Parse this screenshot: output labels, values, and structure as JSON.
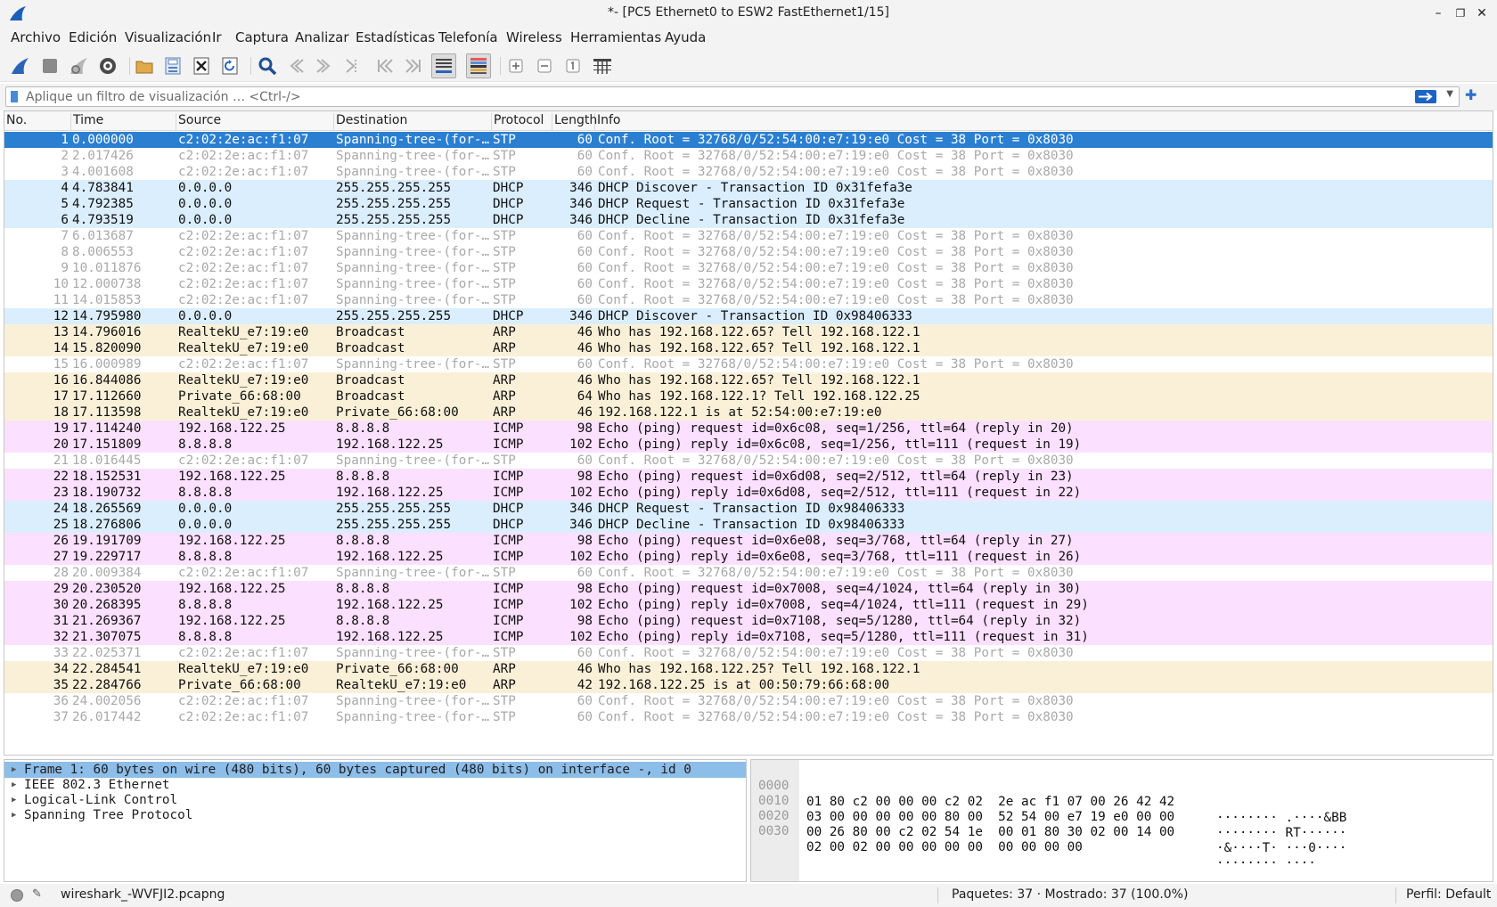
{
  "window": {
    "title": "*- [PC5 Ethernet0 to ESW2 FastEthernet1/15]",
    "controls": {
      "minimize": "–",
      "restore": "❐",
      "close": "✕"
    }
  },
  "menu": {
    "items": [
      {
        "label": "Archivo"
      },
      {
        "label": "Edición"
      },
      {
        "label": "Visualización"
      },
      {
        "label": "Ir"
      },
      {
        "label": "Captura"
      },
      {
        "label": "Analizar"
      },
      {
        "label": "Estadísticas"
      },
      {
        "label": "Telefonía"
      },
      {
        "label": "Wireless"
      },
      {
        "label": "Herramientas"
      },
      {
        "label": "Ayuda"
      }
    ]
  },
  "toolbar": {
    "buttons": [
      "start-capture-icon",
      "stop-capture-icon",
      "restart-capture-icon",
      "capture-options-icon",
      "open-file-icon",
      "save-file-icon",
      "close-file-icon",
      "reload-file-icon",
      "find-packet-icon",
      "go-back-icon",
      "go-forward-icon",
      "go-to-packet-icon",
      "first-packet-icon",
      "last-packet-icon",
      "auto-scroll-icon",
      "colorize-icon",
      "zoom-in-icon",
      "zoom-out-icon",
      "normal-size-icon",
      "resize-columns-icon"
    ]
  },
  "filter": {
    "placeholder": "Aplique un filtro de visualización … <Ctrl-/>"
  },
  "packet_list": {
    "columns": [
      "No.",
      "Time",
      "Source",
      "Destination",
      "Protocol",
      "Length",
      "Info"
    ],
    "rows": [
      {
        "no": "1",
        "time": "0.000000",
        "src": "c2:02:2e:ac:f1:07",
        "dst": "Spanning-tree-(for-…",
        "proto": "STP",
        "len": "60",
        "info": "Conf. Root = 32768/0/52:54:00:e7:19:e0  Cost = 38  Port = 0x8030",
        "cls": "selected"
      },
      {
        "no": "2",
        "time": "2.017426",
        "src": "c2:02:2e:ac:f1:07",
        "dst": "Spanning-tree-(for-…",
        "proto": "STP",
        "len": "60",
        "info": "Conf. Root = 32768/0/52:54:00:e7:19:e0  Cost = 38  Port = 0x8030",
        "cls": "stp"
      },
      {
        "no": "3",
        "time": "4.001608",
        "src": "c2:02:2e:ac:f1:07",
        "dst": "Spanning-tree-(for-…",
        "proto": "STP",
        "len": "60",
        "info": "Conf. Root = 32768/0/52:54:00:e7:19:e0  Cost = 38  Port = 0x8030",
        "cls": "stp"
      },
      {
        "no": "4",
        "time": "4.783841",
        "src": "0.0.0.0",
        "dst": "255.255.255.255",
        "proto": "DHCP",
        "len": "346",
        "info": "DHCP Discover - Transaction ID 0x31fefa3e",
        "cls": "dhcp"
      },
      {
        "no": "5",
        "time": "4.792385",
        "src": "0.0.0.0",
        "dst": "255.255.255.255",
        "proto": "DHCP",
        "len": "346",
        "info": "DHCP Request  - Transaction ID 0x31fefa3e",
        "cls": "dhcp"
      },
      {
        "no": "6",
        "time": "4.793519",
        "src": "0.0.0.0",
        "dst": "255.255.255.255",
        "proto": "DHCP",
        "len": "346",
        "info": "DHCP Decline  - Transaction ID 0x31fefa3e",
        "cls": "dhcp"
      },
      {
        "no": "7",
        "time": "6.013687",
        "src": "c2:02:2e:ac:f1:07",
        "dst": "Spanning-tree-(for-…",
        "proto": "STP",
        "len": "60",
        "info": "Conf. Root = 32768/0/52:54:00:e7:19:e0  Cost = 38  Port = 0x8030",
        "cls": "stp"
      },
      {
        "no": "8",
        "time": "8.006553",
        "src": "c2:02:2e:ac:f1:07",
        "dst": "Spanning-tree-(for-…",
        "proto": "STP",
        "len": "60",
        "info": "Conf. Root = 32768/0/52:54:00:e7:19:e0  Cost = 38  Port = 0x8030",
        "cls": "stp"
      },
      {
        "no": "9",
        "time": "10.011876",
        "src": "c2:02:2e:ac:f1:07",
        "dst": "Spanning-tree-(for-…",
        "proto": "STP",
        "len": "60",
        "info": "Conf. Root = 32768/0/52:54:00:e7:19:e0  Cost = 38  Port = 0x8030",
        "cls": "stp"
      },
      {
        "no": "10",
        "time": "12.000738",
        "src": "c2:02:2e:ac:f1:07",
        "dst": "Spanning-tree-(for-…",
        "proto": "STP",
        "len": "60",
        "info": "Conf. Root = 32768/0/52:54:00:e7:19:e0  Cost = 38  Port = 0x8030",
        "cls": "stp"
      },
      {
        "no": "11",
        "time": "14.015853",
        "src": "c2:02:2e:ac:f1:07",
        "dst": "Spanning-tree-(for-…",
        "proto": "STP",
        "len": "60",
        "info": "Conf. Root = 32768/0/52:54:00:e7:19:e0  Cost = 38  Port = 0x8030",
        "cls": "stp"
      },
      {
        "no": "12",
        "time": "14.795980",
        "src": "0.0.0.0",
        "dst": "255.255.255.255",
        "proto": "DHCP",
        "len": "346",
        "info": "DHCP Discover - Transaction ID 0x98406333",
        "cls": "dhcp"
      },
      {
        "no": "13",
        "time": "14.796016",
        "src": "RealtekU_e7:19:e0",
        "dst": "Broadcast",
        "proto": "ARP",
        "len": "46",
        "info": "Who has 192.168.122.65? Tell 192.168.122.1",
        "cls": "arp"
      },
      {
        "no": "14",
        "time": "15.820090",
        "src": "RealtekU_e7:19:e0",
        "dst": "Broadcast",
        "proto": "ARP",
        "len": "46",
        "info": "Who has 192.168.122.65? Tell 192.168.122.1",
        "cls": "arp"
      },
      {
        "no": "15",
        "time": "16.000989",
        "src": "c2:02:2e:ac:f1:07",
        "dst": "Spanning-tree-(for-…",
        "proto": "STP",
        "len": "60",
        "info": "Conf. Root = 32768/0/52:54:00:e7:19:e0  Cost = 38  Port = 0x8030",
        "cls": "stp"
      },
      {
        "no": "16",
        "time": "16.844086",
        "src": "RealtekU_e7:19:e0",
        "dst": "Broadcast",
        "proto": "ARP",
        "len": "46",
        "info": "Who has 192.168.122.65? Tell 192.168.122.1",
        "cls": "arp"
      },
      {
        "no": "17",
        "time": "17.112660",
        "src": "Private_66:68:00",
        "dst": "Broadcast",
        "proto": "ARP",
        "len": "64",
        "info": "Who has 192.168.122.1? Tell 192.168.122.25",
        "cls": "arp"
      },
      {
        "no": "18",
        "time": "17.113598",
        "src": "RealtekU_e7:19:e0",
        "dst": "Private_66:68:00",
        "proto": "ARP",
        "len": "46",
        "info": "192.168.122.1 is at 52:54:00:e7:19:e0",
        "cls": "arp"
      },
      {
        "no": "19",
        "time": "17.114240",
        "src": "192.168.122.25",
        "dst": "8.8.8.8",
        "proto": "ICMP",
        "len": "98",
        "info": "Echo (ping) request  id=0x6c08, seq=1/256, ttl=64 (reply in 20)",
        "cls": "icmp"
      },
      {
        "no": "20",
        "time": "17.151809",
        "src": "8.8.8.8",
        "dst": "192.168.122.25",
        "proto": "ICMP",
        "len": "102",
        "info": "Echo (ping) reply    id=0x6c08, seq=1/256, ttl=111 (request in 19)",
        "cls": "icmp"
      },
      {
        "no": "21",
        "time": "18.016445",
        "src": "c2:02:2e:ac:f1:07",
        "dst": "Spanning-tree-(for-…",
        "proto": "STP",
        "len": "60",
        "info": "Conf. Root = 32768/0/52:54:00:e7:19:e0  Cost = 38  Port = 0x8030",
        "cls": "stp"
      },
      {
        "no": "22",
        "time": "18.152531",
        "src": "192.168.122.25",
        "dst": "8.8.8.8",
        "proto": "ICMP",
        "len": "98",
        "info": "Echo (ping) request  id=0x6d08, seq=2/512, ttl=64 (reply in 23)",
        "cls": "icmp"
      },
      {
        "no": "23",
        "time": "18.190732",
        "src": "8.8.8.8",
        "dst": "192.168.122.25",
        "proto": "ICMP",
        "len": "102",
        "info": "Echo (ping) reply    id=0x6d08, seq=2/512, ttl=111 (request in 22)",
        "cls": "icmp"
      },
      {
        "no": "24",
        "time": "18.265569",
        "src": "0.0.0.0",
        "dst": "255.255.255.255",
        "proto": "DHCP",
        "len": "346",
        "info": "DHCP Request  - Transaction ID 0x98406333",
        "cls": "dhcp"
      },
      {
        "no": "25",
        "time": "18.276806",
        "src": "0.0.0.0",
        "dst": "255.255.255.255",
        "proto": "DHCP",
        "len": "346",
        "info": "DHCP Decline  - Transaction ID 0x98406333",
        "cls": "dhcp"
      },
      {
        "no": "26",
        "time": "19.191709",
        "src": "192.168.122.25",
        "dst": "8.8.8.8",
        "proto": "ICMP",
        "len": "98",
        "info": "Echo (ping) request  id=0x6e08, seq=3/768, ttl=64 (reply in 27)",
        "cls": "icmp"
      },
      {
        "no": "27",
        "time": "19.229717",
        "src": "8.8.8.8",
        "dst": "192.168.122.25",
        "proto": "ICMP",
        "len": "102",
        "info": "Echo (ping) reply    id=0x6e08, seq=3/768, ttl=111 (request in 26)",
        "cls": "icmp"
      },
      {
        "no": "28",
        "time": "20.009384",
        "src": "c2:02:2e:ac:f1:07",
        "dst": "Spanning-tree-(for-…",
        "proto": "STP",
        "len": "60",
        "info": "Conf. Root = 32768/0/52:54:00:e7:19:e0  Cost = 38  Port = 0x8030",
        "cls": "stp"
      },
      {
        "no": "29",
        "time": "20.230520",
        "src": "192.168.122.25",
        "dst": "8.8.8.8",
        "proto": "ICMP",
        "len": "98",
        "info": "Echo (ping) request  id=0x7008, seq=4/1024, ttl=64 (reply in 30)",
        "cls": "icmp"
      },
      {
        "no": "30",
        "time": "20.268395",
        "src": "8.8.8.8",
        "dst": "192.168.122.25",
        "proto": "ICMP",
        "len": "102",
        "info": "Echo (ping) reply    id=0x7008, seq=4/1024, ttl=111 (request in 29)",
        "cls": "icmp"
      },
      {
        "no": "31",
        "time": "21.269367",
        "src": "192.168.122.25",
        "dst": "8.8.8.8",
        "proto": "ICMP",
        "len": "98",
        "info": "Echo (ping) request  id=0x7108, seq=5/1280, ttl=64 (reply in 32)",
        "cls": "icmp"
      },
      {
        "no": "32",
        "time": "21.307075",
        "src": "8.8.8.8",
        "dst": "192.168.122.25",
        "proto": "ICMP",
        "len": "102",
        "info": "Echo (ping) reply    id=0x7108, seq=5/1280, ttl=111 (request in 31)",
        "cls": "icmp"
      },
      {
        "no": "33",
        "time": "22.025371",
        "src": "c2:02:2e:ac:f1:07",
        "dst": "Spanning-tree-(for-…",
        "proto": "STP",
        "len": "60",
        "info": "Conf. Root = 32768/0/52:54:00:e7:19:e0  Cost = 38  Port = 0x8030",
        "cls": "stp"
      },
      {
        "no": "34",
        "time": "22.284541",
        "src": "RealtekU_e7:19:e0",
        "dst": "Private_66:68:00",
        "proto": "ARP",
        "len": "46",
        "info": "Who has 192.168.122.25? Tell 192.168.122.1",
        "cls": "arp"
      },
      {
        "no": "35",
        "time": "22.284766",
        "src": "Private_66:68:00",
        "dst": "RealtekU_e7:19:e0",
        "proto": "ARP",
        "len": "42",
        "info": "192.168.122.25 is at 00:50:79:66:68:00",
        "cls": "arp"
      },
      {
        "no": "36",
        "time": "24.002056",
        "src": "c2:02:2e:ac:f1:07",
        "dst": "Spanning-tree-(for-…",
        "proto": "STP",
        "len": "60",
        "info": "Conf. Root = 32768/0/52:54:00:e7:19:e0  Cost = 38  Port = 0x8030",
        "cls": "stp"
      },
      {
        "no": "37",
        "time": "26.017442",
        "src": "c2:02:2e:ac:f1:07",
        "dst": "Spanning-tree-(for-…",
        "proto": "STP",
        "len": "60",
        "info": "Conf. Root = 32768/0/52:54:00:e7:19:e0  Cost = 38  Port = 0x8030",
        "cls": "stp"
      }
    ]
  },
  "details": {
    "items": [
      {
        "label": "Frame 1: 60 bytes on wire (480 bits), 60 bytes captured (480 bits) on interface -, id 0",
        "selected": true
      },
      {
        "label": "IEEE 802.3 Ethernet",
        "selected": false
      },
      {
        "label": "Logical-Link Control",
        "selected": false
      },
      {
        "label": "Spanning Tree Protocol",
        "selected": false
      }
    ]
  },
  "bytes": {
    "rows": [
      {
        "offset": "0000",
        "hex": "01 80 c2 00 00 00 c2 02  2e ac f1 07 00 26 42 42",
        "ascii": "········ .····&BB"
      },
      {
        "offset": "0010",
        "hex": "03 00 00 00 00 00 80 00  52 54 00 e7 19 e0 00 00",
        "ascii": "········ RT······"
      },
      {
        "offset": "0020",
        "hex": "00 26 80 00 c2 02 54 1e  00 01 80 30 02 00 14 00",
        "ascii": "·&····T· ···0····"
      },
      {
        "offset": "0030",
        "hex": "02 00 02 00 00 00 00 00  00 00 00 00",
        "ascii": "········ ····"
      }
    ]
  },
  "status": {
    "file": "wireshark_-WVFJI2.pcapng",
    "packets": "Paquetes: 37 · Mostrado: 37 (100.0%)",
    "profile": "Perfil: Default"
  },
  "colors": {
    "selected": "#2b7fd1",
    "dhcp": "#daeefe",
    "arp": "#faf0d8",
    "icmp": "#fce0ff",
    "stp_text": "#a9a9a9"
  }
}
